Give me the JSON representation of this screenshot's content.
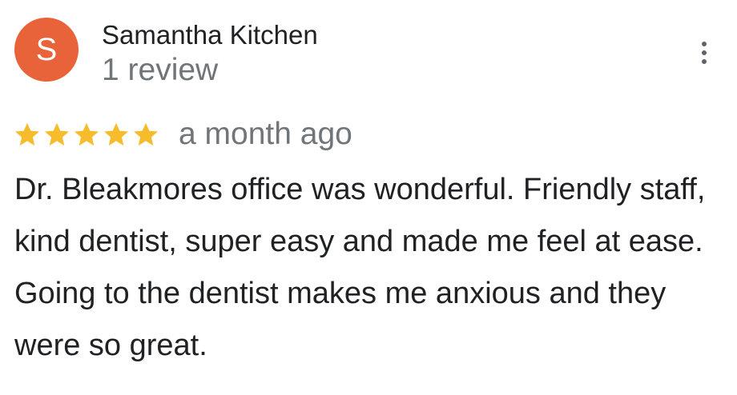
{
  "reviewer": {
    "avatar_letter": "S",
    "avatar_color": "#e8623a",
    "name": "Samantha Kitchen",
    "review_count": "1 review"
  },
  "more_menu_icon": "more-vertical-icon",
  "review": {
    "rating": 5,
    "rating_max": 5,
    "star_color": "#f6bc2c",
    "date": "a month ago",
    "text": "Dr. Bleakmores office was wonderful. Friendly staff, kind dentist, super easy and made me feel at ease. Going to the dentist makes me anxious and they were so great."
  }
}
